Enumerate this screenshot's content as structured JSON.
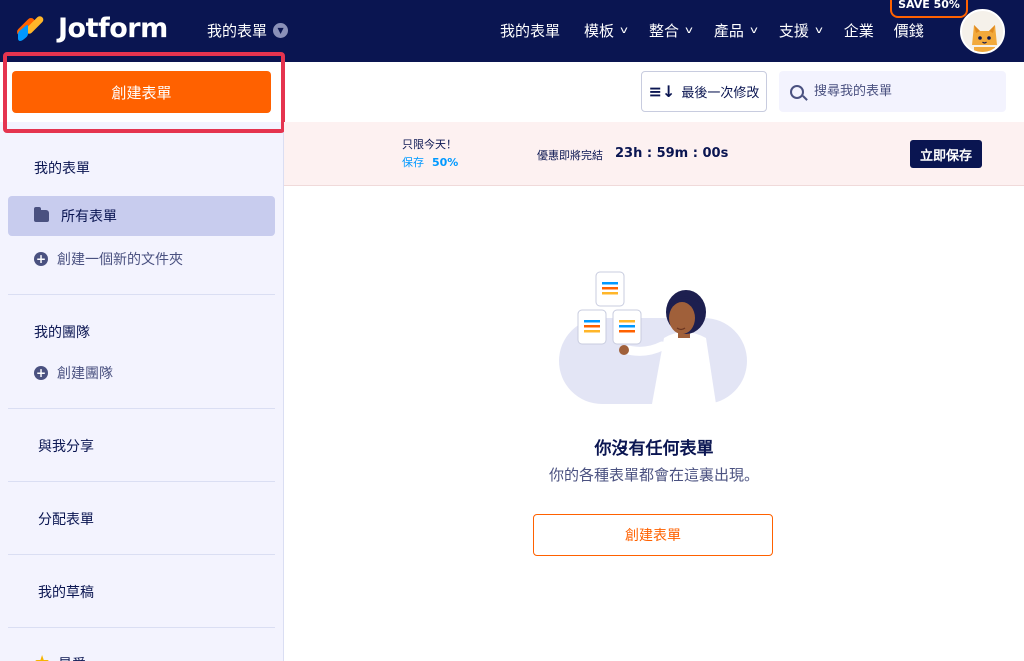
{
  "header": {
    "brand": "Jotform",
    "my_forms_dropdown": "我的表單",
    "nav": [
      {
        "label": "我的表單",
        "has_dropdown": false
      },
      {
        "label": "模板",
        "has_dropdown": true
      },
      {
        "label": "整合",
        "has_dropdown": true
      },
      {
        "label": "產品",
        "has_dropdown": true
      },
      {
        "label": "支援",
        "has_dropdown": true
      },
      {
        "label": "企業",
        "has_dropdown": false
      },
      {
        "label": "價錢",
        "has_dropdown": false
      }
    ],
    "save_badge": "SAVE 50%",
    "chevron": "⌄"
  },
  "sidebar": {
    "create_button": "創建表單",
    "my_forms_heading": "我的表單",
    "all_forms": "所有表單",
    "new_folder": "創建一個新的文件夾",
    "my_teams_heading": "我的團隊",
    "create_team": "創建團隊",
    "shared_with_me": "與我分享",
    "assigned_forms": "分配表單",
    "my_drafts": "我的草稿",
    "favorites": "最愛"
  },
  "toolbar": {
    "sort_label": "最後一次修改",
    "search_placeholder": "搜尋我的表單"
  },
  "promo": {
    "only_today": "只限今天！",
    "save_label": "保存",
    "save_percent": "50%",
    "ends_label": "優惠即將完結",
    "timer": "23h : 59m : 00s",
    "cta": "立即保存"
  },
  "empty_state": {
    "title": "你沒有任何表單",
    "subtitle": "你的各種表單都會在這裏出現。",
    "button": "創建表單"
  },
  "colors": {
    "navy": "#0a1551",
    "orange": "#ff6100",
    "highlight_red": "#e5344f",
    "sidebar_bg": "#f3f3fe",
    "active_item": "#c8ccee"
  }
}
